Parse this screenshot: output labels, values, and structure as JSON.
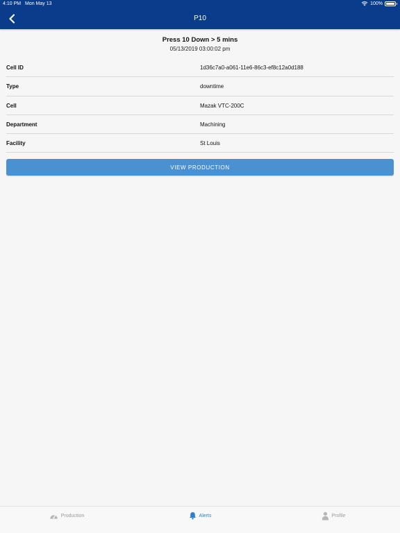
{
  "status_bar": {
    "time": "4:10 PM",
    "date": "Mon May 13",
    "battery": "100%",
    "icons": [
      "wifi-icon",
      "battery-icon"
    ]
  },
  "nav": {
    "title": "P10",
    "back_icon": "chevron-left-icon"
  },
  "alert": {
    "title": "Press 10 Down > 5 mins",
    "datetime": "05/13/2019 03:00:02 pm"
  },
  "details": [
    {
      "label": "Cell ID",
      "value": "1d36c7a0-a061-11e6-86c3-ef8c12a0d188"
    },
    {
      "label": "Type",
      "value": "downtime"
    },
    {
      "label": "Cell",
      "value": "Mazak VTC-200C"
    },
    {
      "label": "Department",
      "value": "Machining"
    },
    {
      "label": "Facility",
      "value": "St Louis"
    }
  ],
  "view_button": {
    "label": "VIEW PRODUCTION"
  },
  "tabs": [
    {
      "label": "Production",
      "icon": "gauge-icon",
      "active": false
    },
    {
      "label": "Alerts",
      "icon": "bell-icon",
      "active": true
    },
    {
      "label": "Profile",
      "icon": "person-icon",
      "active": false
    }
  ],
  "colors": {
    "nav_bar": "#0a3c8c",
    "button": "#4b90d0",
    "tab_active": "#2e7fcf",
    "tab_inactive": "#999999",
    "background": "#f6f6f6"
  }
}
